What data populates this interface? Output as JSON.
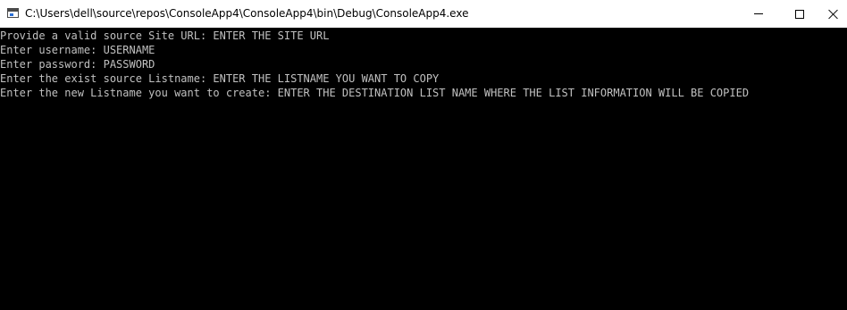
{
  "window": {
    "title": "C:\\Users\\dell\\source\\repos\\ConsoleApp4\\ConsoleApp4\\bin\\Debug\\ConsoleApp4.exe",
    "icon": "console-app-icon",
    "buttons": {
      "minimize": "minimize-icon",
      "maximize": "maximize-icon",
      "close": "close-icon"
    }
  },
  "console": {
    "background": "#000000",
    "foreground": "#c0c0c0",
    "lines": [
      "Provide a valid source Site URL: ENTER THE SITE URL",
      "Enter username: USERNAME",
      "Enter password: PASSWORD",
      "Enter the exist source Listname: ENTER THE LISTNAME YOU WANT TO COPY",
      "Enter the new Listname you want to create: ENTER THE DESTINATION LIST NAME WHERE THE LIST INFORMATION WILL BE COPIED"
    ]
  }
}
